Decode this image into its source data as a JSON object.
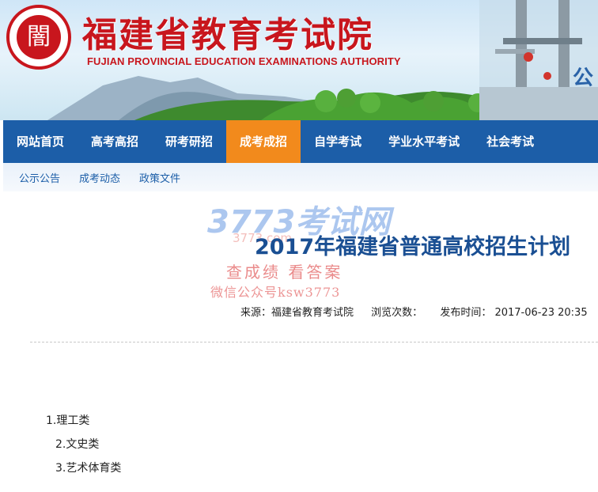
{
  "header": {
    "logo_text": "闇",
    "title_cn": "福建省教育考试院",
    "title_en": "FUJIAN PROVINCIAL EDUCATION EXAMINATIONS AUTHORITY",
    "right_text": "公"
  },
  "nav": {
    "items": [
      {
        "label": "网站首页"
      },
      {
        "label": "高考高招"
      },
      {
        "label": "研考研招"
      },
      {
        "label": "成考成招"
      },
      {
        "label": "自学考试"
      },
      {
        "label": "学业水平考试"
      },
      {
        "label": "社会考试"
      }
    ],
    "active_index": 3
  },
  "subnav": {
    "items": [
      {
        "label": "公示公告"
      },
      {
        "label": "成考动态"
      },
      {
        "label": "政策文件"
      }
    ]
  },
  "watermark": {
    "brand": "3773考试网",
    "url": "3773.com",
    "slogan": "查成绩 看答案",
    "wechat": "微信公众号ksw3773"
  },
  "article": {
    "title": "2017年福建省普通高校招生计划",
    "source": "来源：福建省教育考试院",
    "views": "浏览次数：",
    "published": "发布时间：  2017-06-23 20:35",
    "items": [
      {
        "text": "1.理工类"
      },
      {
        "text": "2.文史类"
      },
      {
        "text": "3.艺术体育类"
      }
    ]
  },
  "colors": {
    "nav_bg": "#1c5ea8",
    "nav_active": "#f28a1c",
    "brand_red": "#c8161d",
    "title_blue": "#1a4f93"
  }
}
